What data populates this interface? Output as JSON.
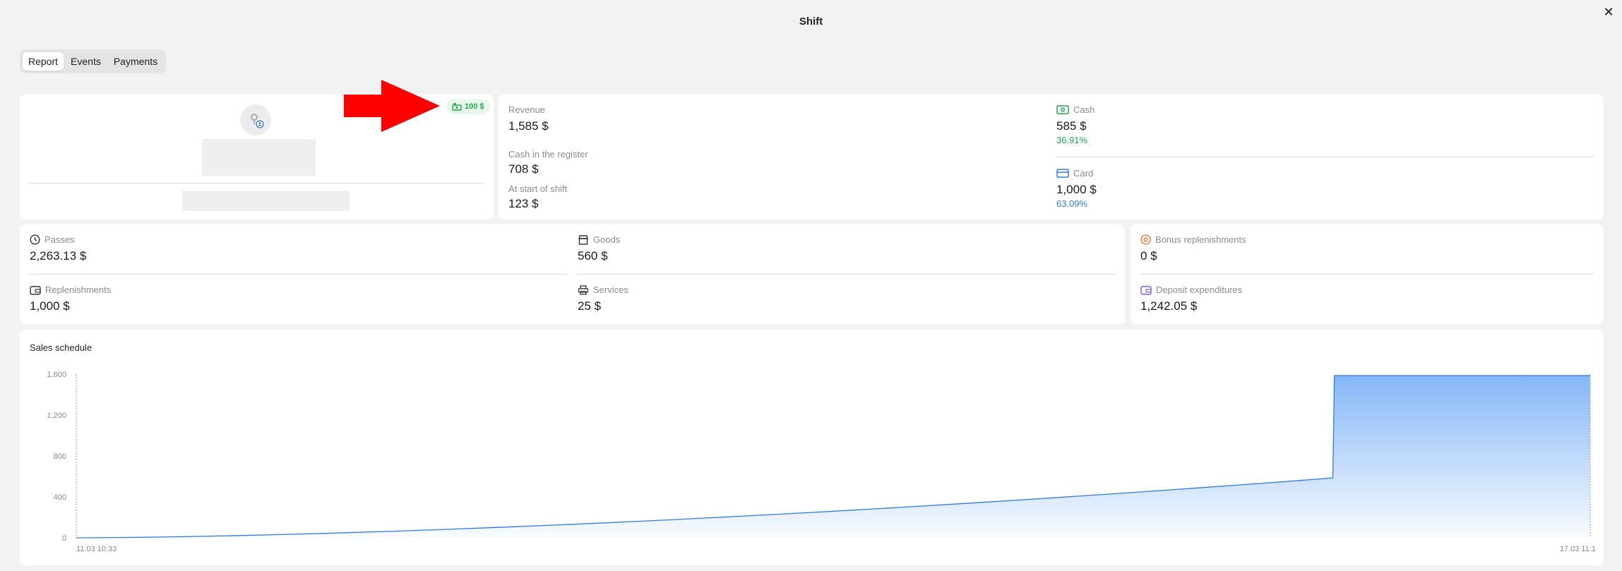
{
  "window": {
    "title": "Shift",
    "close_glyph": "✕"
  },
  "tabs": [
    {
      "label": "Report",
      "active": true
    },
    {
      "label": "Events",
      "active": false
    },
    {
      "label": "Payments",
      "active": false
    }
  ],
  "profile": {
    "badge": "100 $",
    "badge_icon": "cash-icon",
    "avatar_icon": "user-icon"
  },
  "revenue": {
    "revenue_label": "Revenue",
    "revenue_value": "1,585 $",
    "register_label": "Cash in the register",
    "register_value": "708 $",
    "start_label": "At start of shift",
    "start_value": "123 $"
  },
  "payment_split": {
    "cash_label": "Cash",
    "cash_value": "585 $",
    "cash_pct": "36.91%",
    "card_label": "Card",
    "card_value": "1,000 $",
    "card_pct": "63.09%"
  },
  "categories": {
    "passes_label": "Passes",
    "passes_value": "2,263.13 $",
    "goods_label": "Goods",
    "goods_value": "560 $",
    "replenishments_label": "Replenishments",
    "replenishments_value": "1,000 $",
    "services_label": "Services",
    "services_value": "25 $"
  },
  "bonus": {
    "bonus_label": "Bonus replenishments",
    "bonus_value": "0 $",
    "deposit_label": "Deposit expenditures",
    "deposit_value": "1,242.05 $"
  },
  "colors": {
    "green": "#22a852",
    "blue": "#2f7be5",
    "orange": "#e8772e",
    "purple": "#7b5ce6",
    "chart_fill": "#7fb3f7",
    "annotation_arrow": "#ff0000"
  },
  "chart_data": {
    "type": "area",
    "title": "Sales schedule",
    "x_tick_labels": [
      "11.03 10:33",
      "17.03 11:1"
    ],
    "y_ticks": [
      0,
      400,
      800,
      1200,
      1600
    ],
    "ylim": [
      0,
      1600
    ],
    "x": [
      0,
      0.83,
      0.831,
      1
    ],
    "y": [
      0,
      585,
      1585,
      1585
    ],
    "grid": false,
    "legend": "none"
  }
}
